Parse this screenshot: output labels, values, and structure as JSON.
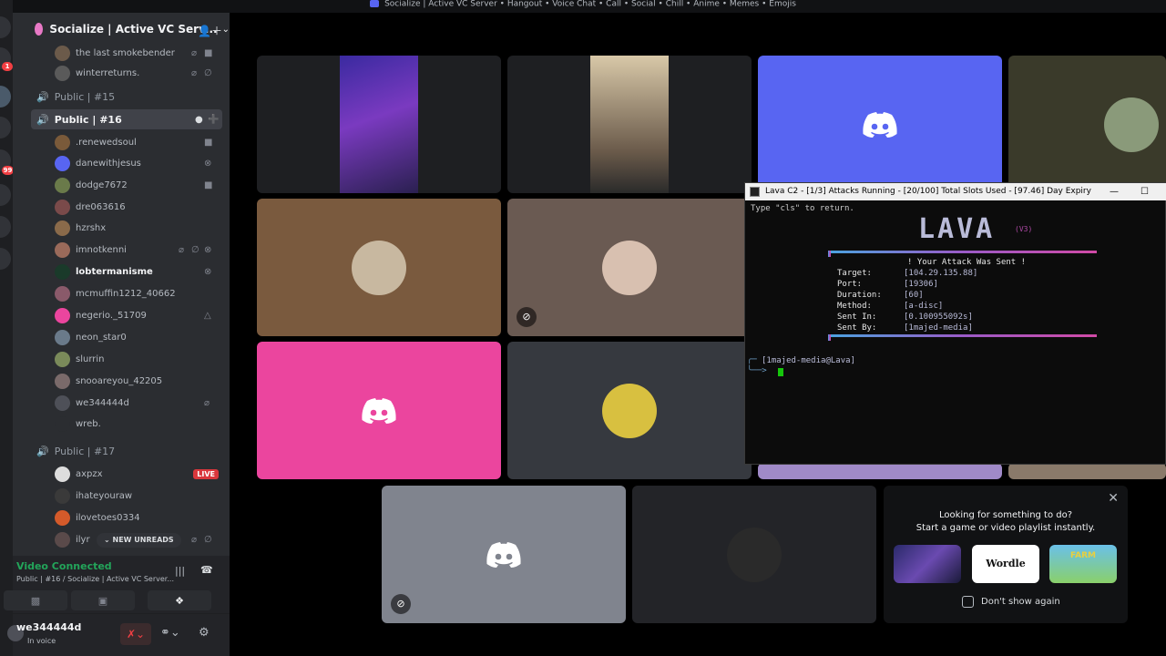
{
  "window_title": "Socialize | Active VC Server • Hangout • Voice Chat • Call • Social • Chill • Anime • Memes • Emojis",
  "server": {
    "name": "Socialize | Active VC Serv...",
    "chevron": "⌄"
  },
  "rail": {
    "badges": [
      "1",
      "99"
    ]
  },
  "sidebar": {
    "rows": [
      {
        "kind": "user",
        "name": "the last smokebender",
        "avatar_color": "#6b5a4a",
        "icons": [
          "mic-muted-icon",
          "camera-icon"
        ]
      },
      {
        "kind": "user",
        "name": "winterreturns.",
        "avatar_color": "#5a5a5a",
        "icons": [
          "mic-muted-icon",
          "deafened-icon"
        ]
      },
      {
        "kind": "channel",
        "name": "Public | #15"
      },
      {
        "kind": "channel",
        "name": "Public | #16",
        "active": true
      },
      {
        "kind": "user",
        "name": ".renewedsoul",
        "avatar_color": "#7a5a3a",
        "icons": [
          "camera-icon"
        ]
      },
      {
        "kind": "user",
        "name": "danewithjesus",
        "avatar_color": "#5865f2",
        "icons": [
          "xbox-icon"
        ]
      },
      {
        "kind": "user",
        "name": "dodge7672",
        "avatar_color": "#6a7a4a",
        "icons": [
          "camera-icon"
        ]
      },
      {
        "kind": "user",
        "name": "dre063616",
        "avatar_color": "#7a4a4a",
        "icons": []
      },
      {
        "kind": "user",
        "name": "hzrshx",
        "avatar_color": "#8a6a4a",
        "icons": []
      },
      {
        "kind": "user",
        "name": "imnotkenni",
        "avatar_color": "#9a6a5a",
        "icons": [
          "mic-muted-icon",
          "deafened-icon",
          "xbox-icon"
        ]
      },
      {
        "kind": "user",
        "name": "lobtermanisme",
        "avatar_color": "#1a3a2a",
        "bright": true,
        "icons": [
          "xbox-icon"
        ]
      },
      {
        "kind": "user",
        "name": "mcmuffin1212_40662",
        "avatar_color": "#8a5a6a",
        "icons": []
      },
      {
        "kind": "user",
        "name": "negerio._51709",
        "avatar_color": "#eb459e",
        "icons": [
          "playstation-icon"
        ]
      },
      {
        "kind": "user",
        "name": "neon_star0",
        "avatar_color": "#6a7a8a",
        "icons": []
      },
      {
        "kind": "user",
        "name": "slurrin",
        "avatar_color": "#7a8a5a",
        "icons": []
      },
      {
        "kind": "user",
        "name": "snooareyou_42205",
        "avatar_color": "#7a6a6a",
        "icons": []
      },
      {
        "kind": "user",
        "name": "we344444d",
        "avatar_color": "#4e5058",
        "icons": [
          "mic-muted-icon"
        ]
      },
      {
        "kind": "user",
        "name": "wreb.",
        "avatar_color": "#2b2d31",
        "icons": []
      },
      {
        "kind": "channel",
        "name": "Public | #17"
      },
      {
        "kind": "user",
        "name": "axpzx",
        "avatar_color": "#dddddd",
        "icons": [],
        "live": "LIVE"
      },
      {
        "kind": "user",
        "name": "ihateyouraw",
        "avatar_color": "#3a3a3a",
        "icons": []
      },
      {
        "kind": "user",
        "name": "ilovetoes0334",
        "avatar_color": "#d45a2a",
        "icons": []
      },
      {
        "kind": "user",
        "name": "ilyr",
        "avatar_color": "#5a4a4a",
        "icons": [
          "mic-muted-icon",
          "deafened-icon"
        ]
      }
    ],
    "new_unreads": "NEW UNREADS"
  },
  "voice": {
    "status": "Video Connected",
    "subtitle": "Public | #16 / Socialize | Active VC Server..."
  },
  "user": {
    "name": "we344444d",
    "status": "In voice"
  },
  "terminal": {
    "title": "Lava C2  -  [1/3] Attacks Running   -   [20/100] Total Slots Used   -   [97.46] Day Expiry",
    "hint": "Type \"cls\" to return.",
    "logo": "LAVA",
    "version": "(V3)",
    "banner": "! Your Attack Was Sent !",
    "fields": [
      {
        "label": "Target:",
        "value": "[104.29.135.88]"
      },
      {
        "label": "Port:",
        "value": "[19306]"
      },
      {
        "label": "Duration:",
        "value": "[60]"
      },
      {
        "label": "Method:",
        "value": "[a-disc]"
      },
      {
        "label": "Sent In:",
        "value": "[0.100955092s]"
      },
      {
        "label": "Sent By:",
        "value": "[1majed-media]"
      }
    ],
    "prompt": "[1majed-media@Lava]"
  },
  "activity": {
    "line1": "Looking for something to do?",
    "line2": "Start a game or video playlist instantly.",
    "cards": [
      "",
      "Wordle",
      "FARM"
    ],
    "dont_show": "Don't show again"
  },
  "colors": {
    "discord_blurple": "#5865f2",
    "discord_pink": "#eb459e",
    "connected_green": "#23a55a",
    "live_red": "#da373c",
    "terminal_green": "#16c60c"
  }
}
